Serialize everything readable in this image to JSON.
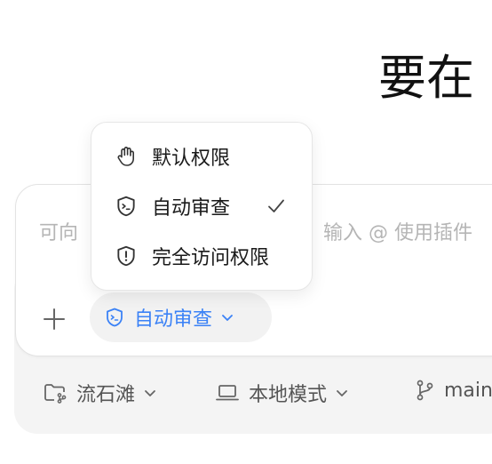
{
  "headline": "要在",
  "composer": {
    "placeholder_left": "可向",
    "placeholder_right": "输入 @ 使用插件"
  },
  "mode_pill": {
    "label": "自动审查",
    "icon": "shield-terminal-icon"
  },
  "permission_menu": {
    "items": [
      {
        "label": "默认权限",
        "icon": "hand-icon",
        "selected": false
      },
      {
        "label": "自动审查",
        "icon": "shield-terminal-icon",
        "selected": true
      },
      {
        "label": "完全访问权限",
        "icon": "shield-alert-icon",
        "selected": false
      }
    ]
  },
  "footer": {
    "project": {
      "label": "流石滩",
      "icon": "folder-git-icon"
    },
    "location": {
      "label": "本地模式",
      "icon": "laptop-icon"
    },
    "branch": {
      "label": "main",
      "icon": "git-branch-icon"
    }
  },
  "colors": {
    "accent": "#3b82f6",
    "pill_bg": "#f2f2f2",
    "panel_bg": "#f4f4f4"
  }
}
